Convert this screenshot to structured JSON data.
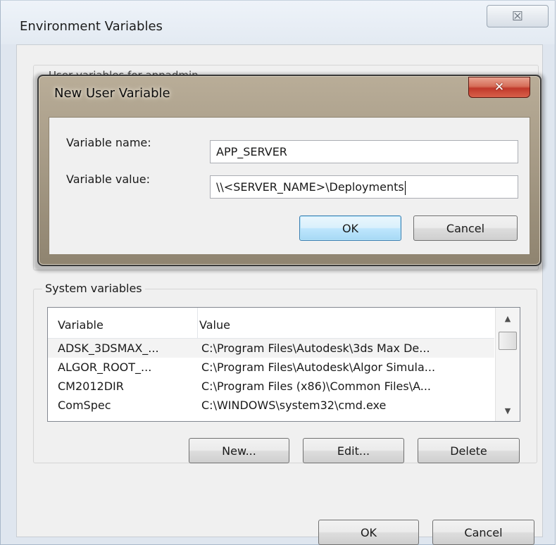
{
  "env_dialog": {
    "title": "Environment Variables",
    "close_glyph": "☒"
  },
  "user_variables": {
    "label": "User variables for appadmin"
  },
  "system_variables": {
    "label": "System variables",
    "columns": [
      "Variable",
      "Value"
    ],
    "rows": [
      {
        "variable": "ADSK_3DSMAX_...",
        "value": "C:\\Program Files\\Autodesk\\3ds Max De..."
      },
      {
        "variable": "ALGOR_ROOT_...",
        "value": "C:\\Program Files\\Autodesk\\Algor Simula..."
      },
      {
        "variable": "CM2012DIR",
        "value": "C:\\Program Files (x86)\\Common Files\\A..."
      },
      {
        "variable": "ComSpec",
        "value": "C:\\WINDOWS\\system32\\cmd.exe"
      }
    ],
    "new_label": "New...",
    "edit_label": "Edit...",
    "delete_label": "Delete"
  },
  "footer": {
    "ok_label": "OK",
    "cancel_label": "Cancel"
  },
  "new_user_variable": {
    "title": "New User Variable",
    "close_glyph": "✕",
    "name_label": "Variable name:",
    "name_value": "APP_SERVER",
    "value_label": "Variable value:",
    "value_value": "\\\\<SERVER_NAME>\\Deployments",
    "ok_label": "OK",
    "cancel_label": "Cancel"
  }
}
